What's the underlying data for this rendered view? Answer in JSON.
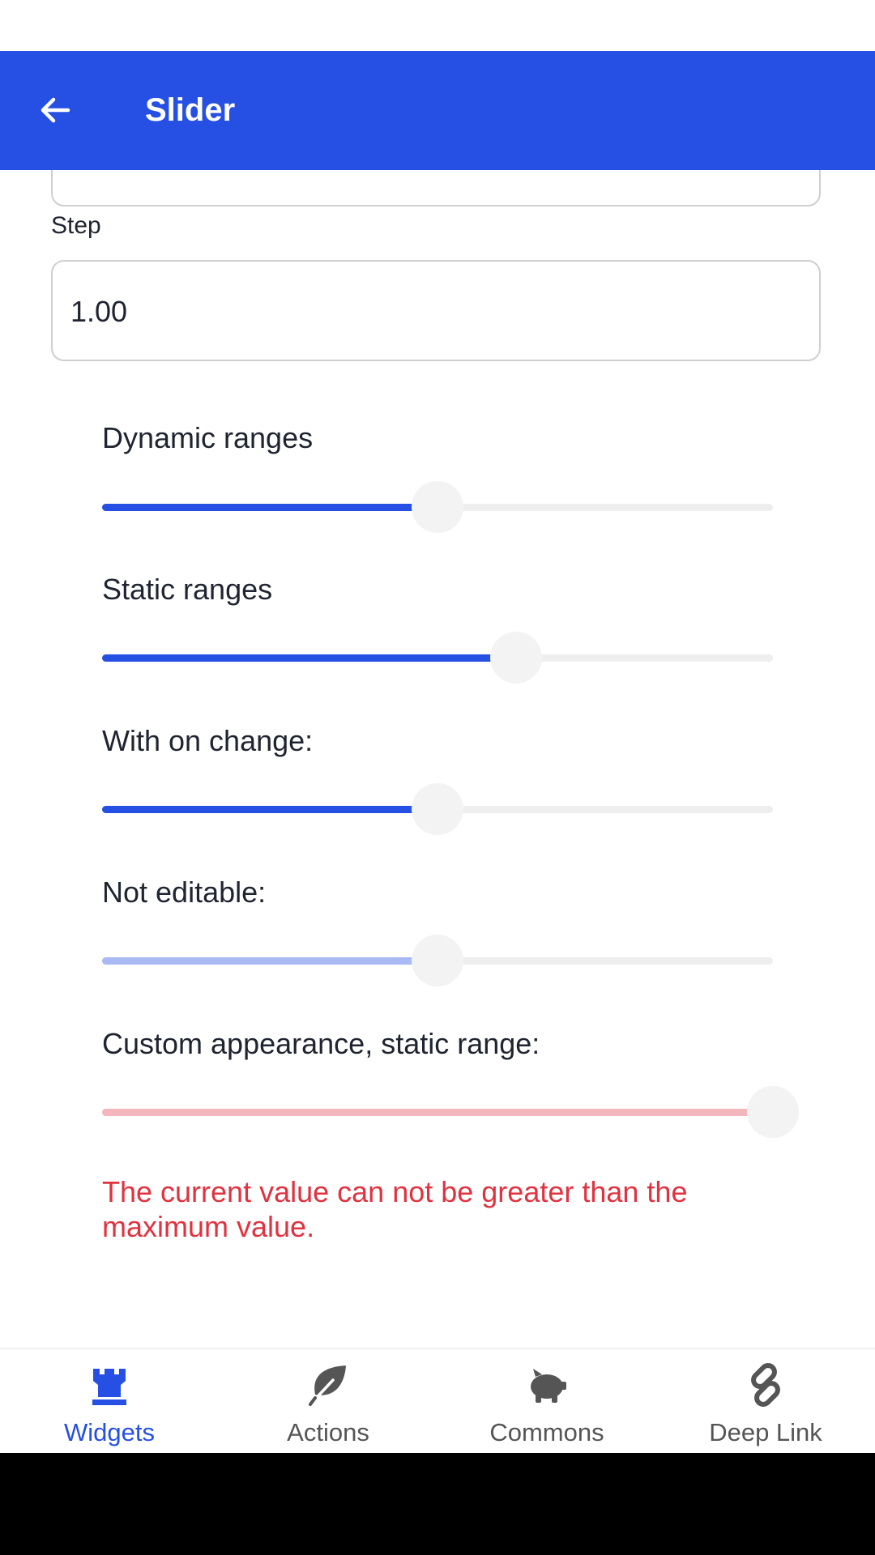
{
  "app_bar": {
    "title": "Slider"
  },
  "form": {
    "step_label": "Step",
    "step_value": "1.00"
  },
  "sliders": [
    {
      "label": "Dynamic ranges",
      "value_fraction": 0.5,
      "enabled": true
    },
    {
      "label": "Static ranges",
      "value_fraction": 0.617,
      "enabled": true
    },
    {
      "label": "With on change:",
      "value_fraction": 0.5,
      "enabled": true
    },
    {
      "label": "Not editable:",
      "value_fraction": 0.5,
      "enabled": false
    },
    {
      "label": "Custom appearance, static range:",
      "value_fraction": 1.0,
      "enabled": true
    }
  ],
  "error": {
    "message": "The current value can not be greater than the maximum value."
  },
  "bottom_nav": {
    "items": [
      {
        "label": "Widgets",
        "icon": "rook-icon",
        "active": true
      },
      {
        "label": "Actions",
        "icon": "leaf-icon",
        "active": false
      },
      {
        "label": "Commons",
        "icon": "piggy-bank-icon",
        "active": false
      },
      {
        "label": "Deep Link",
        "icon": "link-icon",
        "active": false
      }
    ]
  },
  "colors": {
    "primary": "#2650E4",
    "primary_disabled": "#a9b9f3",
    "custom_track": "#f3b6bc",
    "error": "#e0323f",
    "inactive_nav": "#555555"
  }
}
